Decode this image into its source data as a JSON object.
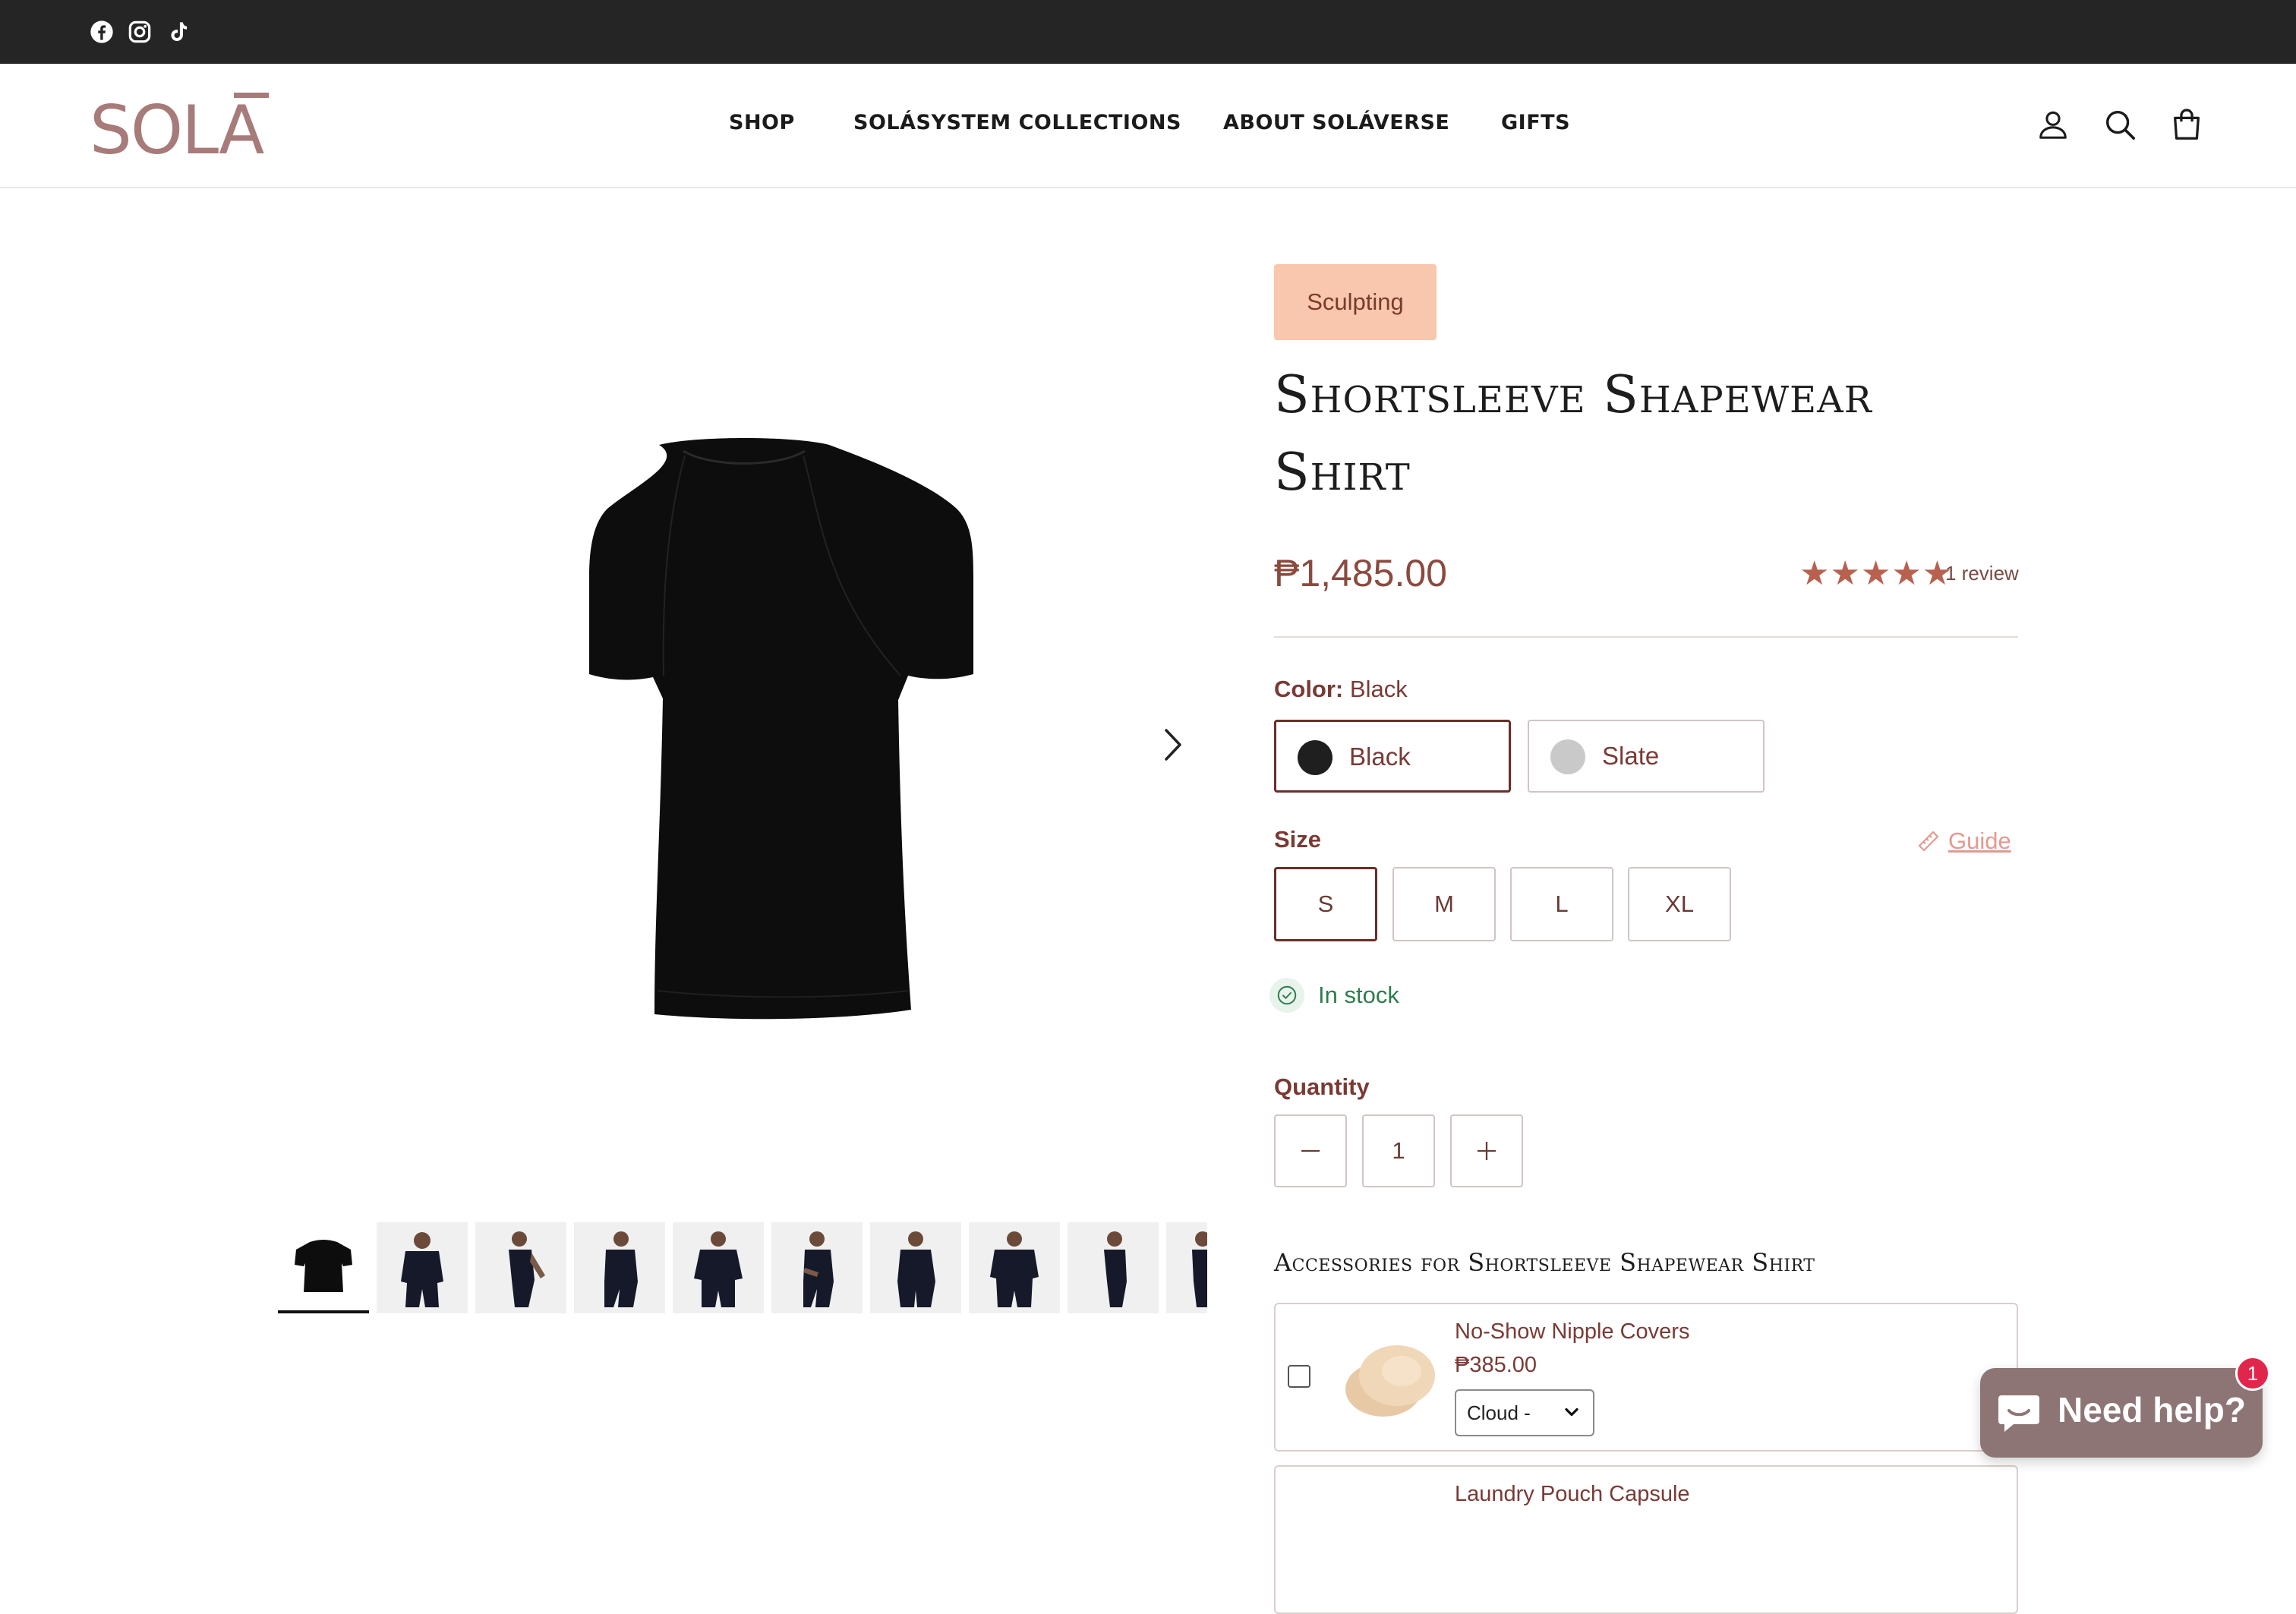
{
  "topbar": {
    "social": [
      {
        "icon": "facebook-icon"
      },
      {
        "icon": "instagram-icon"
      },
      {
        "icon": "tiktok-icon"
      }
    ]
  },
  "header": {
    "logo_text": "SOLĀ",
    "nav": [
      "SHOP",
      "SOLÁSYSTEM COLLECTIONS",
      "ABOUT SOLÁVERSE",
      "GIFTS"
    ],
    "icons": [
      "account-icon",
      "search-icon",
      "cart-icon"
    ]
  },
  "gallery": {
    "thumbnail_count": 10,
    "active_index": 0
  },
  "product": {
    "badge": "Sculpting",
    "title_line1": "Shortsleeve Shapewear",
    "title_line2": "Shirt",
    "price": "₱1,485.00",
    "stars": "★★★★★",
    "rating": 5,
    "review_count": "1 review",
    "color_label": "Color:",
    "color_value": "Black",
    "colors": [
      {
        "name": "Black",
        "hex": "#1f1f1f",
        "selected": true
      },
      {
        "name": "Slate",
        "hex": "#c9c9c9",
        "selected": false
      }
    ],
    "size_label": "Size",
    "guide_label": "Guide",
    "sizes": [
      "S",
      "M",
      "L",
      "XL"
    ],
    "selected_size": "S",
    "stock_text": "In stock",
    "quantity_label": "Quantity",
    "quantity": "1"
  },
  "accessories": {
    "title": "Accessories for Shortsleeve Shapewear Shirt",
    "items": [
      {
        "name": "No-Show Nipple Covers",
        "price": "₱385.00",
        "variant": "Cloud -"
      },
      {
        "name": "Laundry Pouch Capsule",
        "price": "",
        "variant": ""
      }
    ]
  },
  "chat": {
    "label": "Need help?",
    "badge": "1"
  },
  "colors": {
    "topbar": "#252525",
    "accent": "#6b2e2a",
    "badge_bg": "#f8c7ad",
    "stars": "#b8614f",
    "stock": "#2e7d4f",
    "chat": "#8d7576"
  }
}
